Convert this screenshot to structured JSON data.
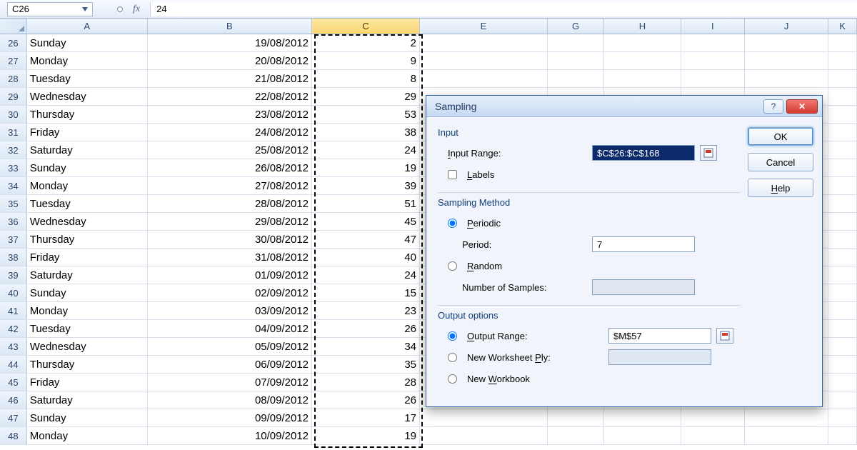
{
  "namebox": "C26",
  "fx_label": "fx",
  "formula": "24",
  "columns": [
    "A",
    "B",
    "C",
    "E",
    "G",
    "H",
    "I",
    "J",
    "K"
  ],
  "rows": [
    {
      "n": 26,
      "a": "Sunday",
      "b": "19/08/2012",
      "c": "2"
    },
    {
      "n": 27,
      "a": "Monday",
      "b": "20/08/2012",
      "c": "9"
    },
    {
      "n": 28,
      "a": "Tuesday",
      "b": "21/08/2012",
      "c": "8"
    },
    {
      "n": 29,
      "a": "Wednesday",
      "b": "22/08/2012",
      "c": "29"
    },
    {
      "n": 30,
      "a": "Thursday",
      "b": "23/08/2012",
      "c": "53"
    },
    {
      "n": 31,
      "a": "Friday",
      "b": "24/08/2012",
      "c": "38"
    },
    {
      "n": 32,
      "a": "Saturday",
      "b": "25/08/2012",
      "c": "24"
    },
    {
      "n": 33,
      "a": "Sunday",
      "b": "26/08/2012",
      "c": "19"
    },
    {
      "n": 34,
      "a": "Monday",
      "b": "27/08/2012",
      "c": "39"
    },
    {
      "n": 35,
      "a": "Tuesday",
      "b": "28/08/2012",
      "c": "51"
    },
    {
      "n": 36,
      "a": "Wednesday",
      "b": "29/08/2012",
      "c": "45"
    },
    {
      "n": 37,
      "a": "Thursday",
      "b": "30/08/2012",
      "c": "47"
    },
    {
      "n": 38,
      "a": "Friday",
      "b": "31/08/2012",
      "c": "40"
    },
    {
      "n": 39,
      "a": "Saturday",
      "b": "01/09/2012",
      "c": "24"
    },
    {
      "n": 40,
      "a": "Sunday",
      "b": "02/09/2012",
      "c": "15"
    },
    {
      "n": 41,
      "a": "Monday",
      "b": "03/09/2012",
      "c": "23"
    },
    {
      "n": 42,
      "a": "Tuesday",
      "b": "04/09/2012",
      "c": "26"
    },
    {
      "n": 43,
      "a": "Wednesday",
      "b": "05/09/2012",
      "c": "34"
    },
    {
      "n": 44,
      "a": "Thursday",
      "b": "06/09/2012",
      "c": "35"
    },
    {
      "n": 45,
      "a": "Friday",
      "b": "07/09/2012",
      "c": "28"
    },
    {
      "n": 46,
      "a": "Saturday",
      "b": "08/09/2012",
      "c": "26"
    },
    {
      "n": 47,
      "a": "Sunday",
      "b": "09/09/2012",
      "c": "17"
    },
    {
      "n": 48,
      "a": "Monday",
      "b": "10/09/2012",
      "c": "19"
    }
  ],
  "dialog": {
    "title": "Sampling",
    "help_char": "?",
    "close_char": "✕",
    "ok": "OK",
    "cancel": "Cancel",
    "help": "Help",
    "input_section": "Input",
    "input_range_label_pre": "I",
    "input_range_label_post": "nput Range:",
    "input_range_value": "$C$26:$C$168",
    "labels_pre": "L",
    "labels_post": "abels",
    "method_section": "Sampling Method",
    "periodic_pre": "P",
    "periodic_post": "eriodic",
    "period_label": "Period:",
    "period_value": "7",
    "random_pre": "R",
    "random_post": "andom",
    "num_samples_label": "Number of Samples:",
    "num_samples_value": "",
    "output_section": "Output options",
    "output_range_pre": "O",
    "output_range_post": "utput Range:",
    "output_range_value": "$M$57",
    "new_ply_label": "New Worksheet ",
    "new_ply_pre": "P",
    "new_ply_post": "ly:",
    "new_ply_value": "",
    "new_wb_pre1": "New ",
    "new_wb_u": "W",
    "new_wb_post": "orkbook"
  }
}
